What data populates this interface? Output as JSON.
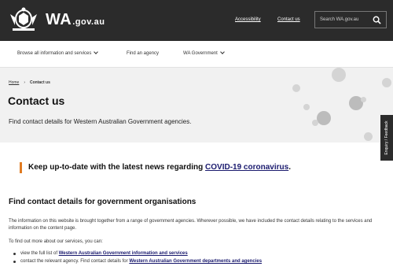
{
  "header": {
    "logo_main": "WA",
    "logo_sub": ".gov.au",
    "links": [
      "Accessibility",
      "Contact us"
    ],
    "search_placeholder": "Search WA.gov.au"
  },
  "nav": {
    "items": [
      "Browse all information and services",
      "Find an agency",
      "WA Government"
    ]
  },
  "breadcrumb": {
    "home": "Home",
    "separator": "›",
    "current": "Contact us"
  },
  "hero": {
    "title": "Contact us",
    "subtitle": "Find contact details for Western Australian Government agencies."
  },
  "feedback_tab": "Enquiry / Feedback",
  "alert": {
    "text": "Keep up-to-date with the latest news regarding ",
    "link": "COVID-19 coronavirus",
    "end": "."
  },
  "main": {
    "heading": "Find contact details for government organisations",
    "para1": "The information on this website is brought together from a range of government agencies. Wherever possible, we have included the contact details relating to the services and information on the content page.",
    "para2": "To find out more about our services, you can:",
    "bullets": [
      {
        "text": "view the full list of ",
        "link": "Western Australian Government information and services"
      },
      {
        "text": "contact the relevant agency. Find contact details for ",
        "link": "Western Australian Government departments and agencies"
      }
    ]
  },
  "icons": [
    "crest-icon",
    "search-icon",
    "chevron-down-icon"
  ],
  "colors": {
    "topbar": "#2b2b2b",
    "hero_bg": "#f1f1f1",
    "alert_accent": "#e07b22",
    "link": "#1a1a6e"
  }
}
